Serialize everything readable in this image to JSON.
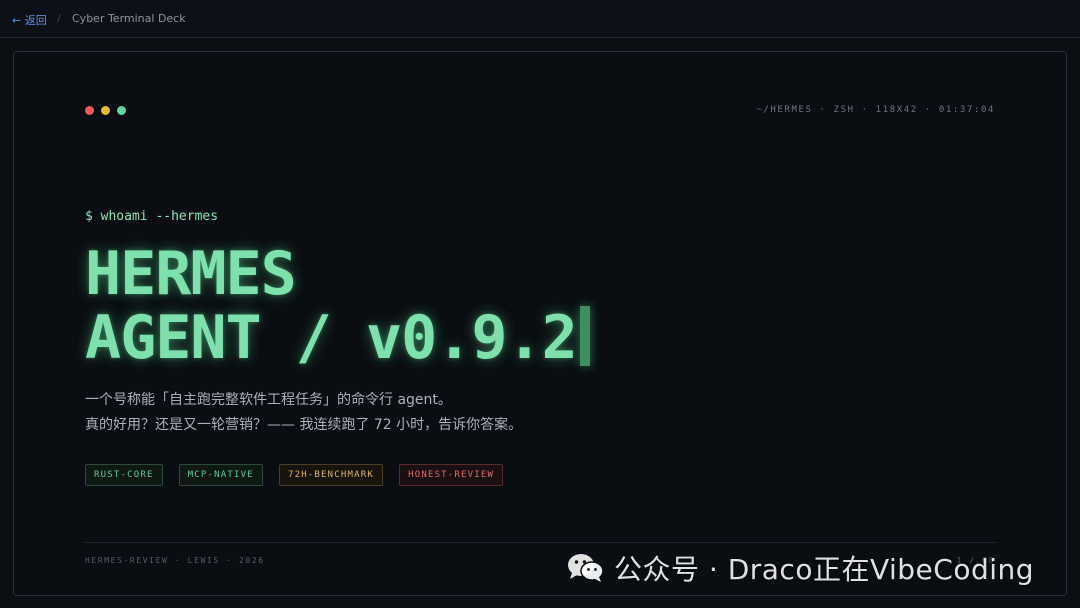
{
  "topbar": {
    "back_label": "← 返回",
    "separator": "/",
    "breadcrumb": "Cyber Terminal Deck"
  },
  "window": {
    "status_line": "~/HERMES · ZSH · 118X42 · 01:37:04",
    "dot_colors": [
      "#ef5a5a",
      "#e6b93a",
      "#62d39b"
    ]
  },
  "hero": {
    "prompt": "$ whoami --hermes",
    "title_line1": "HERMES",
    "title_line2": "AGENT / v0.9.2",
    "desc_line1": "一个号称能「自主跑完整软件工程任务」的命令行 agent。",
    "desc_line2": "真的好用？还是又一轮营销？—— 我连续跑了 72 小时，告诉你答案。"
  },
  "tags": [
    {
      "label": "RUST-CORE",
      "color": "#62c79a"
    },
    {
      "label": "MCP-NATIVE",
      "color": "#62c79a"
    },
    {
      "label": "72H-BENCHMARK",
      "color": "#d9b46a"
    },
    {
      "label": "HONEST-REVIEW",
      "color": "#e06a6a"
    }
  ],
  "footer": {
    "left": "HERMES-REVIEW · LEWIS · 2026",
    "right": "1 / 08"
  },
  "watermark": {
    "text": "公众号 · Draco正在VibeCoding",
    "icon": "wechat-icon"
  }
}
